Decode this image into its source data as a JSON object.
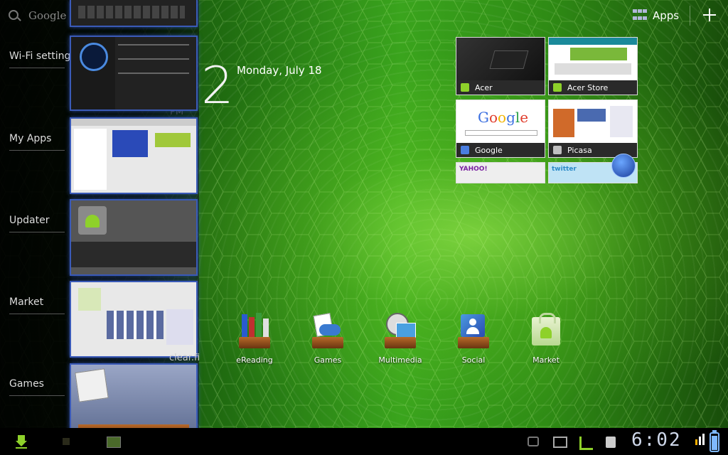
{
  "search": {
    "label": "Google"
  },
  "recents": {
    "labels": [
      "Wi-Fi setting",
      "My Apps",
      "Updater",
      "Market",
      "Games"
    ],
    "partial_text": "clear.fi"
  },
  "clock": {
    "digit": "2",
    "date": "Monday, July 18",
    "ampm": "PM"
  },
  "actionbar": {
    "apps_label": "Apps"
  },
  "bookmarks": [
    {
      "label": "Acer",
      "icon_color": "#8ed12a"
    },
    {
      "label": "Acer Store",
      "icon_color": "#8ed12a"
    },
    {
      "label": "Google",
      "icon_color": "#4a7ee0"
    },
    {
      "label": "Picasa",
      "icon_color": "#c0c0c0"
    }
  ],
  "bookmarks_partial": [
    "YAHOO!",
    "twitter"
  ],
  "folders": [
    {
      "label": "eReading",
      "icon": "books-icon"
    },
    {
      "label": "Games",
      "icon": "gamepad-icon"
    },
    {
      "label": "Multimedia",
      "icon": "film-reel-icon"
    },
    {
      "label": "Social",
      "icon": "contact-icon"
    },
    {
      "label": "Market",
      "icon": "market-bag-icon"
    }
  ],
  "sysbar": {
    "time": "6:02"
  },
  "colors": {
    "accent": "#8ed12a",
    "thumb_border": "#3a5ab8",
    "clock": "#cfd8ea"
  }
}
